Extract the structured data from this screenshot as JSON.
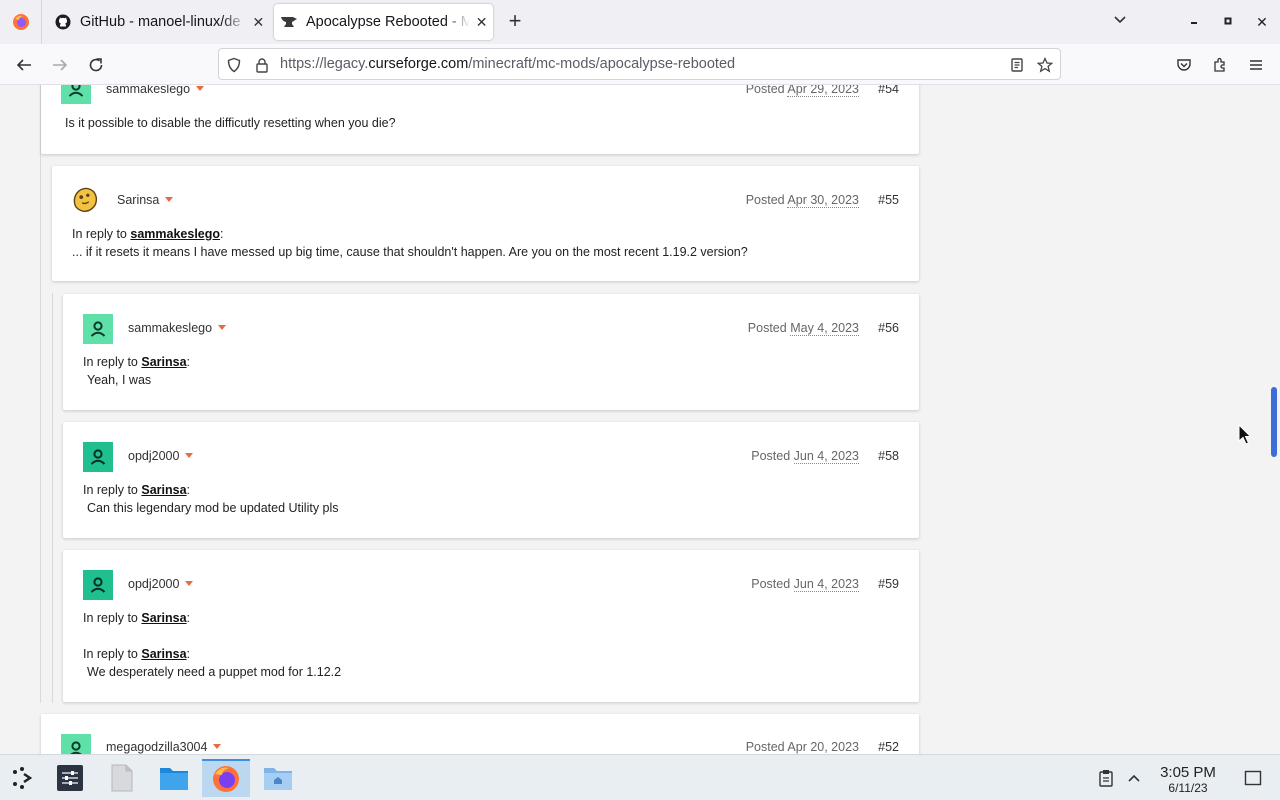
{
  "browser": {
    "tabs": [
      {
        "title": "GitHub - manoel-linux/de",
        "icon": "github-icon"
      },
      {
        "title": "Apocalypse Rebooted - M",
        "icon": "curseforge-anvil-icon",
        "active": true
      }
    ],
    "url": {
      "prefix": "https://legacy.",
      "domain": "curseforge.com",
      "path": "/minecraft/mc-mods/apocalypse-rebooted"
    }
  },
  "comments": [
    {
      "user": "sammakeslego",
      "posted_label": "Posted",
      "date": "Apr 29, 2023",
      "number": "#54",
      "lines": [
        "Is it possible to disable the difficutly resetting when you die?"
      ]
    },
    {
      "user": "Sarinsa",
      "posted_label": "Posted",
      "date": "Apr 30, 2023",
      "number": "#55",
      "reply_label": "In reply to",
      "reply_to": "sammakeslego",
      "lines": [
        "... if it resets it means I have messed up big time, cause that shouldn't happen. Are you on the most recent 1.19.2 version?"
      ]
    },
    {
      "user": "sammakeslego",
      "posted_label": "Posted",
      "date": "May 4, 2023",
      "number": "#56",
      "reply_label": "In reply to",
      "reply_to": "Sarinsa",
      "lines": [
        "Yeah, I was"
      ]
    },
    {
      "user": "opdj2000",
      "posted_label": "Posted",
      "date": "Jun 4, 2023",
      "number": "#58",
      "reply_label": "In reply to",
      "reply_to": "Sarinsa",
      "lines": [
        "Can this legendary mod be updated Utility pls"
      ]
    },
    {
      "user": "opdj2000",
      "posted_label": "Posted",
      "date": "Jun 4, 2023",
      "number": "#59",
      "reply_label": "In reply to",
      "reply_to": "Sarinsa",
      "reply_label_2": "In reply to",
      "reply_to_2": "Sarinsa",
      "lines": [
        "We desperately need a puppet mod for 1.12.2"
      ]
    },
    {
      "user": "megagodzilla3004",
      "posted_label": "Posted",
      "date": "Apr 20, 2023",
      "number": "#52"
    }
  ],
  "taskbar": {
    "time": "3:05 PM",
    "date": "6/11/23"
  },
  "colors": {
    "avatar_green": "#5ee0a8",
    "avatar_teal": "#1fbf8f",
    "caret": "#e86a3f",
    "scroll_thumb": "#3b6fd6"
  }
}
